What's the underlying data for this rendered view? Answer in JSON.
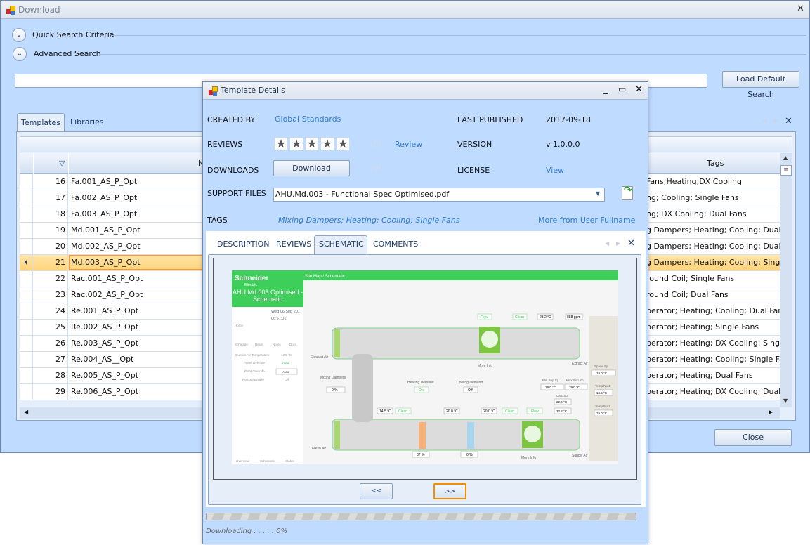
{
  "main_window": {
    "title": "Download",
    "close_glyph": "✕"
  },
  "search": {
    "quick_search": "Quick Search Criteria",
    "advanced_search": "Advanced Search",
    "input_value": "",
    "load_default": "Load Default Search"
  },
  "tabs": [
    {
      "label": "Templates",
      "active": true
    },
    {
      "label": "Libraries",
      "active": false
    }
  ],
  "grid": {
    "headers": {
      "name": "N",
      "tags": "Tags"
    },
    "rows": [
      {
        "num": "16",
        "name": "Fa.001_AS_P_Opt",
        "tags": "Fans;Heating;DX Cooling"
      },
      {
        "num": "17",
        "name": "Fa.002_AS_P_Opt",
        "tags": "ng; Cooling; Single Fans"
      },
      {
        "num": "18",
        "name": "Fa.003_AS_P_Opt",
        "tags": "ng; DX Cooling; Dual Fans"
      },
      {
        "num": "19",
        "name": "Md.001_AS_P_Opt",
        "tags": "g Dampers; Heating; Cooling; Dual Fa"
      },
      {
        "num": "20",
        "name": "Md.002_AS_P_Opt",
        "tags": "g Dampers; Heating; Cooling; Dual Fa"
      },
      {
        "num": "21",
        "name": "Md.003_AS_P_Opt",
        "tags": "g Dampers; Heating; Cooling; Single",
        "selected": true
      },
      {
        "num": "22",
        "name": "Rac.001_AS_P_Opt",
        "tags": "round Coil; Single Fans"
      },
      {
        "num": "23",
        "name": "Rac.002_AS_P_Opt",
        "tags": "round Coil; Dual Fans"
      },
      {
        "num": "24",
        "name": "Re.001_AS_P_Opt",
        "tags": "perator; Heating; Cooling; Dual Fans"
      },
      {
        "num": "25",
        "name": "Re.002_AS_P_Opt",
        "tags": "perator; Heating; Single Fans"
      },
      {
        "num": "26",
        "name": "Re.003_AS_P_Opt",
        "tags": "perator; Heating; DX Cooling; Single F"
      },
      {
        "num": "27",
        "name": "Re.004_AS__Opt",
        "tags": "perator; Heating; Cooling; Single Fans"
      },
      {
        "num": "28",
        "name": "Re.005_AS_P_Opt",
        "tags": "perator; Heating; Dual Fans"
      },
      {
        "num": "29",
        "name": "Re.006_AS_P_Opt",
        "tags": "perator; Heating; DX Cooling; Dual Fa"
      }
    ]
  },
  "close_button": "Close",
  "dialog": {
    "title": "Template Details",
    "created_by_label": "CREATED BY",
    "created_by": "Global Standards",
    "reviews_label": "REVIEWS",
    "rating": 0,
    "max_rating": 5,
    "review_count": "(0)",
    "review_link": "Review",
    "downloads_label": "DOWNLOADS",
    "download_button": "Download",
    "download_count": "(9)",
    "support_files_label": "SUPPORT FILES",
    "support_file": "AHU.Md.003 - Functional Spec Optimised.pdf",
    "tags_label": "TAGS",
    "tags": "Mixing Dampers; Heating; Cooling; Single Fans",
    "more_from": "More from User Fullname",
    "last_published_label": "LAST PUBLISHED",
    "last_published": "2017-09-18",
    "version_label": "VERSION",
    "version": "v 1.0.0.0",
    "license_label": "LICENSE",
    "license_link": "View",
    "tabs": [
      {
        "label": "DESCRIPTION"
      },
      {
        "label": "REVIEWS"
      },
      {
        "label": "SCHEMATIC",
        "active": true
      },
      {
        "label": "COMMENTS"
      }
    ],
    "prev_button": "<<",
    "next_button": ">>",
    "progress": 0,
    "status": "Downloading . . . . . 0%"
  },
  "schematic": {
    "brand": "Schneider",
    "brand_sub": "Electric",
    "title": "AHU.Md.003 Optimised - Schematic",
    "breadcrumb": "Site Map / Schematic",
    "date": "Wed 06 Sep 2017",
    "time": "06:51:01",
    "nav": [
      "Home",
      "Schedule",
      "Reset",
      "Notes",
      "Docs"
    ],
    "info": [
      {
        "k": "Outside Air Temperature",
        "v": "12.5 °C"
      },
      {
        "k": "Panel Override",
        "v": "Auto"
      },
      {
        "k": "Plant Override",
        "v": "Auto"
      },
      {
        "k": "Remote Enable",
        "v": "Off"
      }
    ],
    "footer": [
      "Overview",
      "Schematic",
      "Status"
    ],
    "labels": {
      "exhaust": "Exhaust Air",
      "extract": "Extract Air",
      "fresh": "Fresh Air",
      "supply": "Supply Air",
      "mixing": "Mixing Dampers",
      "more_info": "More Info",
      "heating_demand": "Heating Demand",
      "cooling_demand": "Cooling Demand",
      "space_sp": "Space Sp",
      "temp1": "Temp No.1",
      "temp2": "Temp No.2",
      "min_sup": "Min Sup Sp",
      "max_sup": "Max Sup Sp",
      "calc_sp": "Calc Sp"
    },
    "values": {
      "flow": "Flow",
      "clean": "Clean",
      "t_extract": "23.2 °C",
      "co2": "888 ppm",
      "mix": "0 %",
      "heat_on": "On",
      "cool_off": "Off",
      "t1": "14.5 °C",
      "t2": "20.0 °C",
      "t3": "20.0 °C",
      "heat_pct": "87 %",
      "cool_pct": "0 %",
      "space_sp": "19.0 °C",
      "temp1": "18.5 °C",
      "temp2": "19.0 °C",
      "min_sp": "19.0 °C",
      "max_sp": "29.0 °C",
      "calc1": "22.4 °C",
      "calc2": "22.2 °C"
    }
  }
}
